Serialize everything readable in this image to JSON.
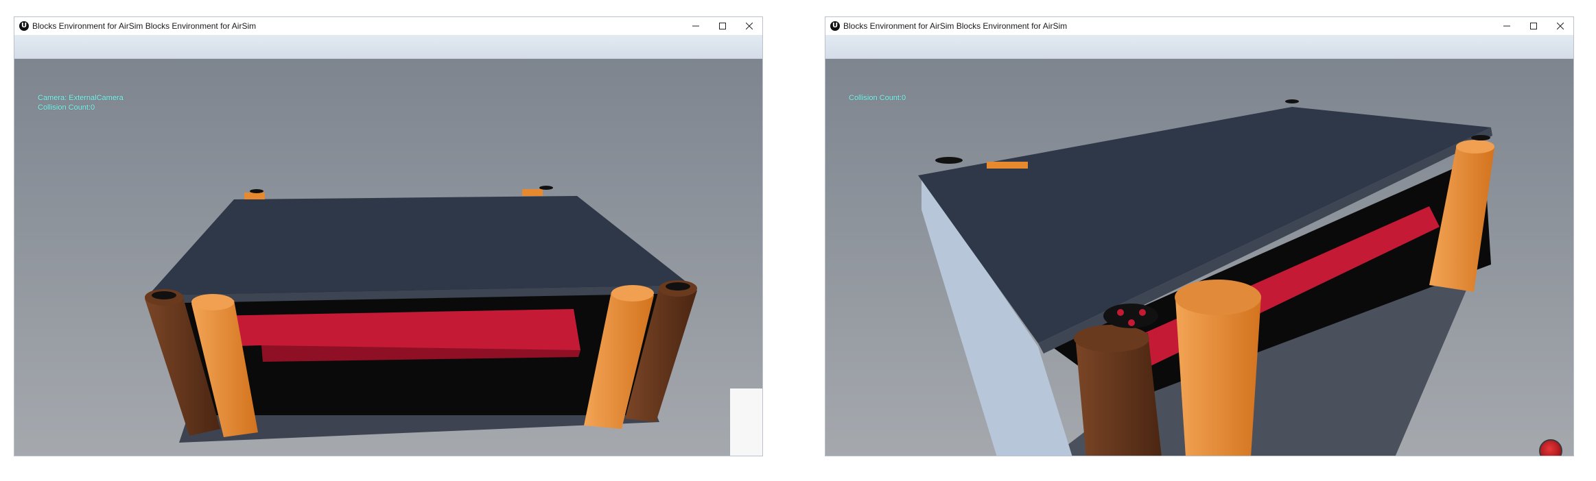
{
  "windows": [
    {
      "title": "Blocks Environment for AirSim Blocks Environment for AirSim",
      "hud": {
        "camera": "Camera: ExternalCamera",
        "collisions": "Collision Count:0"
      }
    },
    {
      "title": "Blocks Environment for AirSim Blocks Environment for AirSim",
      "hud": {
        "collisions": "Collision Count:0"
      }
    }
  ],
  "icons": {
    "app": "unreal-engine-icon",
    "minimize": "minimize-icon",
    "maximize": "maximize-icon",
    "close": "close-icon",
    "record": "record-icon"
  },
  "colors": {
    "tabletop": "#2f3848",
    "red_shelf": "#c41a36",
    "orange_pillar": "#e7892f",
    "brown_pillar": "#6a3a1f",
    "side_panel": "#b7c6d8",
    "sky": "#8d939b",
    "hud_text": "#8df0ea"
  }
}
